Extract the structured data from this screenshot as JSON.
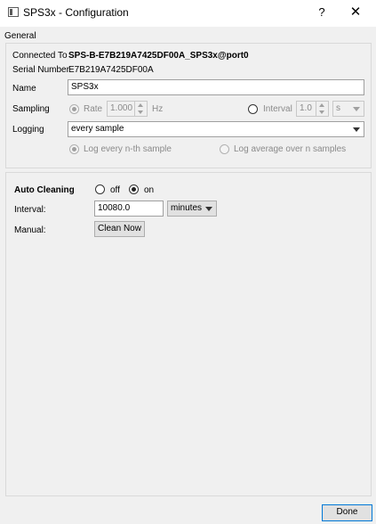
{
  "window": {
    "title": "SPS3x - Configuration",
    "help_glyph": "?",
    "close_glyph": "✕"
  },
  "general": {
    "section_label": "General",
    "connected_to_label": "Connected To",
    "connected_to_value": "SPS-B-E7B219A7425DF00A_SPS3x@port0",
    "serial_label": "Serial Number",
    "serial_value": "E7B219A7425DF00A",
    "name_label": "Name",
    "name_value": "SPS3x",
    "sampling_label": "Sampling",
    "rate_label": "Rate",
    "rate_value": "1.000",
    "rate_unit": "Hz",
    "interval_label": "Interval",
    "interval_value": "1.0",
    "interval_unit": "s",
    "logging_label": "Logging",
    "logging_value": "every sample",
    "log_nth_label": "Log every n-th sample",
    "log_avg_label": "Log average over n samples"
  },
  "cleaning": {
    "auto_label": "Auto Cleaning",
    "off_label": "off",
    "on_label": "on",
    "interval_label": "Interval:",
    "interval_value": "10080.0",
    "interval_unit": "minutes",
    "manual_label": "Manual:",
    "clean_now_label": "Clean Now"
  },
  "footer": {
    "done_label": "Done"
  },
  "colors": {
    "accent": "#0078d7",
    "background": "#f0f0f0"
  }
}
